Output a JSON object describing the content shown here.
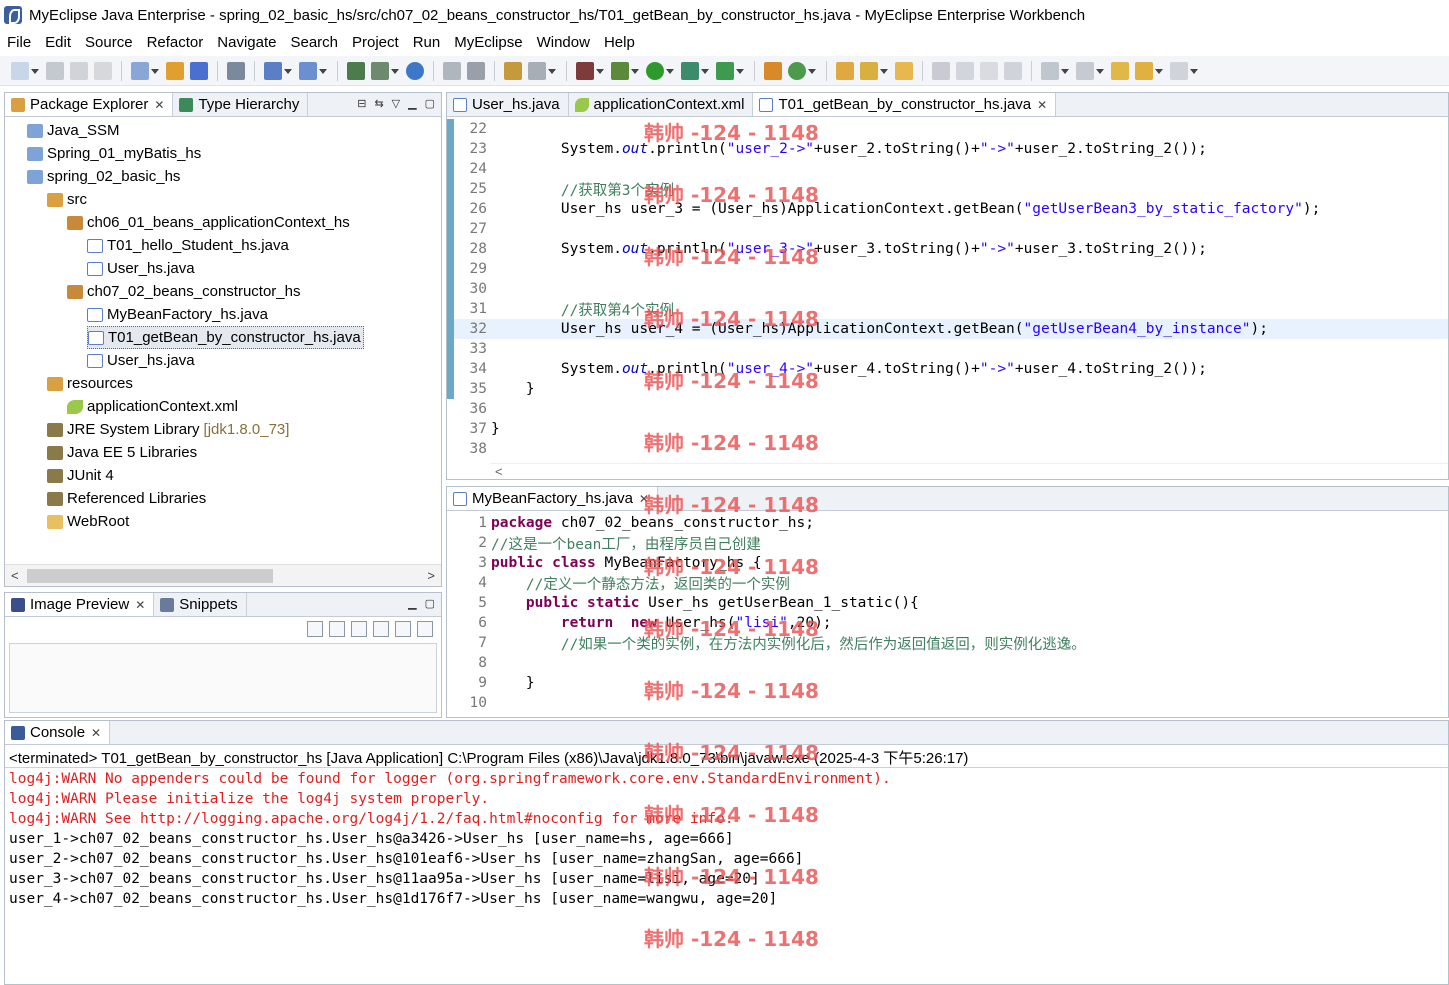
{
  "titlebar": {
    "title": "MyEclipse Java Enterprise - spring_02_basic_hs/src/ch07_02_beans_constructor_hs/T01_getBean_by_constructor_hs.java - MyEclipse Enterprise Workbench"
  },
  "menu": [
    "File",
    "Edit",
    "Source",
    "Refactor",
    "Navigate",
    "Search",
    "Project",
    "Run",
    "MyEclipse",
    "Window",
    "Help"
  ],
  "package_explorer": {
    "tabs": [
      {
        "label": "Package Explorer",
        "icon": "package-explorer-icon"
      },
      {
        "label": "Type Hierarchy",
        "icon": "type-hierarchy-icon"
      }
    ],
    "tree": [
      {
        "label": "Java_SSM",
        "icon": "project-icon"
      },
      {
        "label": "Spring_01_myBatis_hs",
        "icon": "project-icon"
      },
      {
        "label": "spring_02_basic_hs",
        "icon": "project-icon"
      },
      {
        "label": "src",
        "icon": "source-folder-icon"
      },
      {
        "label": "ch06_01_beans_applicationContext_hs",
        "icon": "package-icon"
      },
      {
        "label": "T01_hello_Student_hs.java",
        "icon": "java-file-icon"
      },
      {
        "label": "User_hs.java",
        "icon": "java-file-icon"
      },
      {
        "label": "ch07_02_beans_constructor_hs",
        "icon": "package-icon"
      },
      {
        "label": "MyBeanFactory_hs.java",
        "icon": "java-file-icon"
      },
      {
        "label": "T01_getBean_by_constructor_hs.java",
        "icon": "java-file-icon"
      },
      {
        "label": "User_hs.java",
        "icon": "java-file-icon"
      },
      {
        "label": "resources",
        "icon": "source-folder-icon"
      },
      {
        "label": "applicationContext.xml",
        "icon": "xml-file-icon"
      },
      {
        "label": "JRE System Library",
        "icon": "library-icon",
        "extra": "[jdk1.8.0_73]"
      },
      {
        "label": "Java EE 5 Libraries",
        "icon": "library-icon"
      },
      {
        "label": "JUnit 4",
        "icon": "library-icon"
      },
      {
        "label": "Referenced Libraries",
        "icon": "library-icon"
      },
      {
        "label": "WebRoot",
        "icon": "folder-icon"
      }
    ]
  },
  "image_preview": {
    "tabs": [
      {
        "label": "Image Preview",
        "icon": "image-preview-icon"
      },
      {
        "label": "Snippets",
        "icon": "snippets-icon"
      }
    ]
  },
  "editor": {
    "tabs": [
      {
        "label": "User_hs.java",
        "icon": "java-file-icon"
      },
      {
        "label": "applicationContext.xml",
        "icon": "xml-file-icon"
      },
      {
        "label": "T01_getBean_by_constructor_hs.java",
        "icon": "java-file-icon"
      }
    ],
    "line_numbers": [
      "22",
      "23",
      "24",
      "25",
      "26",
      "27",
      "28",
      "29",
      "30",
      "31",
      "32",
      "33",
      "34",
      "35",
      "36",
      "37",
      "38"
    ]
  },
  "editor2": {
    "tab": {
      "label": "MyBeanFactory_hs.java",
      "icon": "java-file-icon"
    },
    "line_numbers": [
      "1",
      "2",
      "3",
      "4",
      "5",
      "6",
      "7",
      "8",
      "9",
      "10"
    ]
  },
  "console": {
    "tab": {
      "label": "Console",
      "icon": "console-icon"
    },
    "terminated": "<terminated> T01_getBean_by_constructor_hs [Java Application] C:\\Program Files (x86)\\Java\\jdk1.8.0_73\\bin\\javaw.exe (2025-4-3 下午5:26:17)",
    "lines": [
      {
        "text": "log4j:WARN No appenders could be found for logger (org.springframework.core.env.StandardEnvironment).",
        "warn": true
      },
      {
        "text": "log4j:WARN Please initialize the log4j system properly.",
        "warn": true
      },
      {
        "text": "log4j:WARN See http://logging.apache.org/log4j/1.2/faq.html#noconfig for more info.",
        "warn": true
      },
      {
        "text": "user_1->ch07_02_beans_constructor_hs.User_hs@a3426->User_hs [user_name=hs, age=666]",
        "warn": false
      },
      {
        "text": "user_2->ch07_02_beans_constructor_hs.User_hs@101eaf6->User_hs [user_name=zhangSan, age=666]",
        "warn": false
      },
      {
        "text": "user_3->ch07_02_beans_constructor_hs.User_hs@11aa95a->User_hs [user_name=lisi, age=20]",
        "warn": false
      },
      {
        "text": "user_4->ch07_02_beans_constructor_hs.User_hs@1d176f7->User_hs [user_name=wangwu, age=20]",
        "warn": false
      }
    ]
  },
  "watermark": "韩帅 -124 - 1148",
  "colors": {
    "keyword": "#7f0055",
    "string": "#2a00ff",
    "comment": "#3f7f5f",
    "static_field": "#0000c0",
    "warn": "#e02020",
    "watermark": "#ec5050"
  }
}
